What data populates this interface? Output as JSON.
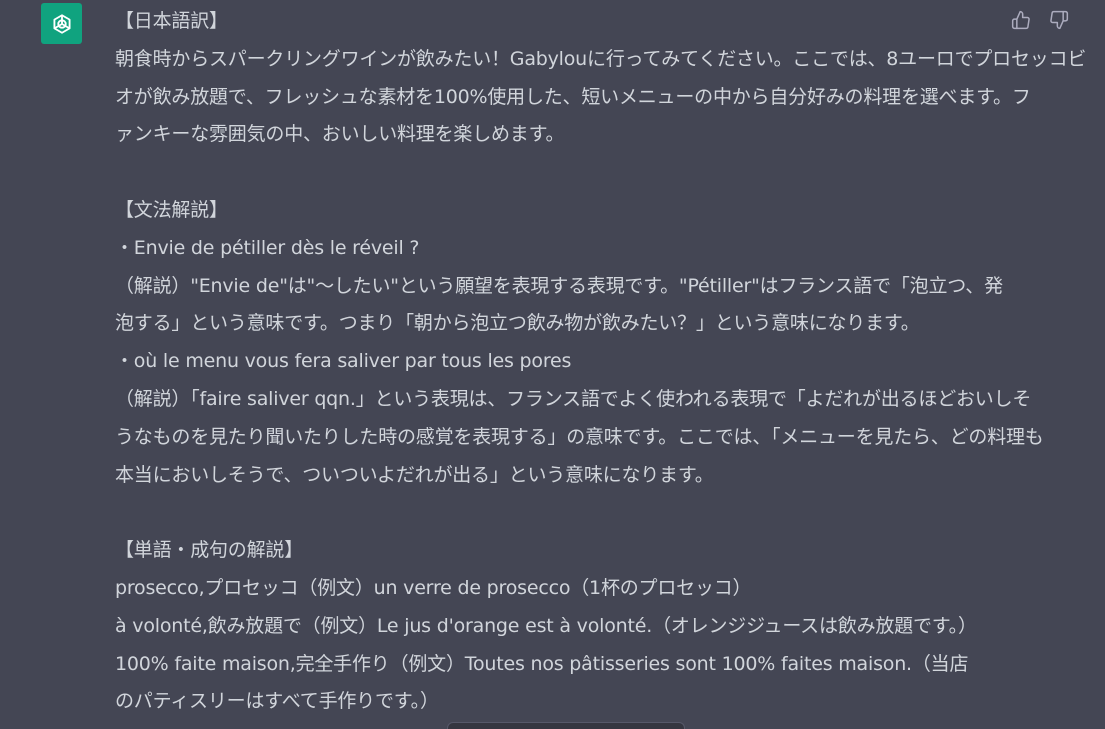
{
  "assistant": {
    "avatar_icon": "openai-logo-icon",
    "avatar_color": "#10a37f"
  },
  "feedback": {
    "thumbs_up_icon": "thumbs-up-icon",
    "thumbs_down_icon": "thumbs-down-icon"
  },
  "message": {
    "translation_heading": "【日本語訳】",
    "translation_lines": [
      "朝食時からスパークリングワインが飲みたい！Gabylouに行ってみてください。ここでは、8ユーロでプロセッコビ",
      "オが飲み放題で、フレッシュな素材を100%使用した、短いメニューの中から自分好みの料理を選べます。フ",
      "ァンキーな雰囲気の中、おいしい料理を楽しめます。"
    ],
    "grammar_heading": "【文法解説】",
    "grammar_lines": [
      "・Envie de pétiller dès le réveil ?",
      "（解説）\"Envie de\"は\"〜したい\"という願望を表現する表現です。\"Pétiller\"はフランス語で「泡立つ、発",
      "泡する」という意味です。つまり「朝から泡立つ飲み物が飲みたい？」という意味になります。",
      "・où le menu vous fera saliver par tous les pores",
      "（解説）「faire saliver qqn.」という表現は、フランス語でよく使われる表現で「よだれが出るほどおいしそ",
      "うなものを見たり聞いたりした時の感覚を表現する」の意味です。ここでは、「メニューを見たら、どの料理も",
      "本当においしそうで、ついついよだれが出る」という意味になります。"
    ],
    "vocab_heading": "【単語・成句の解説】",
    "vocab_lines": [
      "prosecco,プロセッコ（例文）un verre de prosecco（1杯のプロセッコ）",
      "à volonté,飲み放題で（例文）Le jus d'orange est à volonté.（オレンジジュースは飲み放題です。）",
      "100% faite maison,完全手作り（例文）Toutes nos pâtisseries sont 100% faites maison.（当店",
      "のパティスリーはすべて手作りです。）"
    ]
  }
}
